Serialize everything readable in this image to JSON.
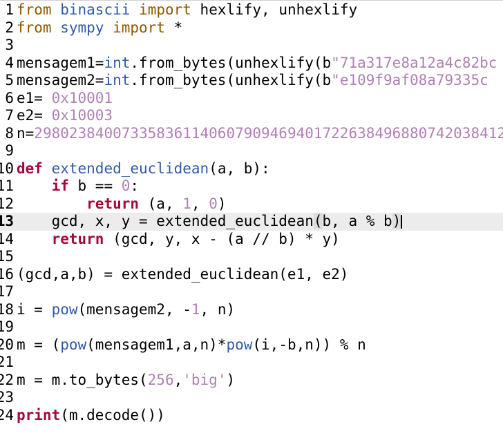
{
  "editor": {
    "current_line": 13,
    "lines": [
      {
        "n": "1",
        "tokens": [
          [
            "kw",
            "from"
          ],
          [
            "op",
            " "
          ],
          [
            "fn",
            "binascii"
          ],
          [
            "op",
            " "
          ],
          [
            "kw",
            "import"
          ],
          [
            "op",
            " hexlify, unhexlify"
          ]
        ]
      },
      {
        "n": "2",
        "tokens": [
          [
            "kw",
            "from"
          ],
          [
            "op",
            " "
          ],
          [
            "fn",
            "sympy"
          ],
          [
            "op",
            " "
          ],
          [
            "kw",
            "import"
          ],
          [
            "op",
            " *"
          ]
        ]
      },
      {
        "n": "3",
        "tokens": []
      },
      {
        "n": "4",
        "tokens": [
          [
            "op",
            "mensagem1="
          ],
          [
            "bi",
            "int"
          ],
          [
            "op",
            ".from_bytes(unhexlify(b"
          ],
          [
            "str",
            "\"71a317e8a12a4c82bc"
          ]
        ]
      },
      {
        "n": "5",
        "tokens": [
          [
            "op",
            "mensagem2="
          ],
          [
            "bi",
            "int"
          ],
          [
            "op",
            ".from_bytes(unhexlify(b"
          ],
          [
            "str",
            "\"e109f9af08a79335c"
          ]
        ]
      },
      {
        "n": "6",
        "tokens": [
          [
            "op",
            "e1= "
          ],
          [
            "num",
            "0x10001"
          ]
        ]
      },
      {
        "n": "7",
        "tokens": [
          [
            "op",
            "e2= "
          ],
          [
            "num",
            "0x10003"
          ]
        ]
      },
      {
        "n": "8",
        "tokens": [
          [
            "op",
            "n="
          ],
          [
            "num",
            "298023840073358361140607909469401722638496880742038412"
          ]
        ]
      },
      {
        "n": "9",
        "tokens": []
      },
      {
        "n": "10",
        "tokens": [
          [
            "kwb",
            "def"
          ],
          [
            "op",
            " "
          ],
          [
            "fn",
            "extended_euclidean"
          ],
          [
            "op",
            "(a, b):"
          ]
        ]
      },
      {
        "n": "11",
        "tokens": [
          [
            "op",
            "    "
          ],
          [
            "kwb",
            "if"
          ],
          [
            "op",
            " b == "
          ],
          [
            "num",
            "0"
          ],
          [
            "op",
            ":"
          ]
        ]
      },
      {
        "n": "12",
        "tokens": [
          [
            "op",
            "        "
          ],
          [
            "kwb",
            "return"
          ],
          [
            "op",
            " (a, "
          ],
          [
            "num",
            "1"
          ],
          [
            "op",
            ", "
          ],
          [
            "num",
            "0"
          ],
          [
            "op",
            ")"
          ]
        ]
      },
      {
        "n": "13",
        "tokens": [
          [
            "op",
            "    gcd, x, y = extended_euclidean"
          ],
          [
            "match",
            "("
          ],
          [
            "op",
            "b, a % b"
          ],
          [
            "match",
            ")"
          ]
        ],
        "caret": true
      },
      {
        "n": "14",
        "tokens": [
          [
            "op",
            "    "
          ],
          [
            "kwb",
            "return"
          ],
          [
            "op",
            " (gcd, y, x - (a // b) * y)"
          ]
        ]
      },
      {
        "n": "15",
        "tokens": []
      },
      {
        "n": "16",
        "tokens": [
          [
            "op",
            "(gcd,a,b) = extended_euclidean(e1, e2)"
          ]
        ]
      },
      {
        "n": "17",
        "tokens": []
      },
      {
        "n": "18",
        "tokens": [
          [
            "op",
            "i = "
          ],
          [
            "bi",
            "pow"
          ],
          [
            "op",
            "(mensagem2, -"
          ],
          [
            "num",
            "1"
          ],
          [
            "op",
            ", n)"
          ]
        ]
      },
      {
        "n": "19",
        "tokens": []
      },
      {
        "n": "20",
        "tokens": [
          [
            "op",
            "m = ("
          ],
          [
            "bi",
            "pow"
          ],
          [
            "op",
            "(mensagem1,a,n)*"
          ],
          [
            "bi",
            "pow"
          ],
          [
            "op",
            "(i,-b,n)) % n"
          ]
        ]
      },
      {
        "n": "21",
        "tokens": []
      },
      {
        "n": "22",
        "tokens": [
          [
            "op",
            "m = m.to_bytes("
          ],
          [
            "num",
            "256"
          ],
          [
            "op",
            ","
          ],
          [
            "str",
            "'big'"
          ],
          [
            "op",
            ")"
          ]
        ]
      },
      {
        "n": "23",
        "tokens": []
      },
      {
        "n": "24",
        "tokens": [
          [
            "kwb",
            "print"
          ],
          [
            "op",
            "(m.decode())"
          ]
        ]
      }
    ]
  }
}
